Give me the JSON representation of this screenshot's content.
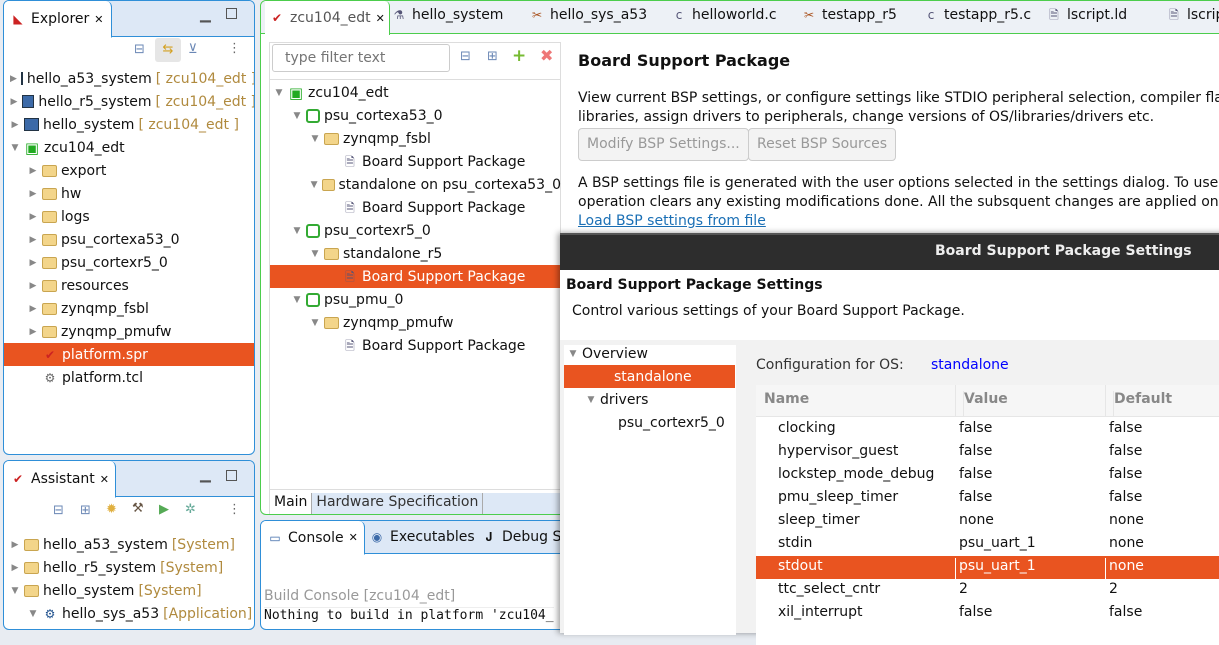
{
  "explorer": {
    "title": "Explorer",
    "items": [
      {
        "label": "hello_a53_system",
        "tag": "[ zcu104_edt ]",
        "expand": "right",
        "icon": "system"
      },
      {
        "label": "hello_r5_system",
        "tag": "[ zcu104_edt ]",
        "expand": "right",
        "icon": "system"
      },
      {
        "label": "hello_system",
        "tag": "[ zcu104_edt ]",
        "expand": "right",
        "icon": "system"
      },
      {
        "label": "zcu104_edt",
        "tag": "",
        "expand": "down",
        "icon": "platform"
      },
      {
        "label": "export",
        "tag": "",
        "expand": "right",
        "icon": "folder"
      },
      {
        "label": "hw",
        "tag": "",
        "expand": "right",
        "icon": "folder"
      },
      {
        "label": "logs",
        "tag": "",
        "expand": "right",
        "icon": "folder"
      },
      {
        "label": "psu_cortexa53_0",
        "tag": "",
        "expand": "right",
        "icon": "folder"
      },
      {
        "label": "psu_cortexr5_0",
        "tag": "",
        "expand": "right",
        "icon": "folder"
      },
      {
        "label": "resources",
        "tag": "",
        "expand": "right",
        "icon": "folder"
      },
      {
        "label": "zynqmp_fsbl",
        "tag": "",
        "expand": "right",
        "icon": "folder"
      },
      {
        "label": "zynqmp_pmufw",
        "tag": "",
        "expand": "right",
        "icon": "folder"
      },
      {
        "label": "platform.spr",
        "tag": "",
        "expand": "",
        "icon": "xilinx",
        "selected": true
      },
      {
        "label": "platform.tcl",
        "tag": "",
        "expand": "",
        "icon": "tcl"
      }
    ]
  },
  "assistant": {
    "title": "Assistant",
    "items": [
      {
        "label": "hello_a53_system",
        "tag": "[System]",
        "expand": "right"
      },
      {
        "label": "hello_r5_system",
        "tag": "[System]",
        "expand": "right"
      },
      {
        "label": "hello_system",
        "tag": "[System]",
        "expand": "down"
      },
      {
        "label": "hello_sys_a53",
        "tag": "[Application]",
        "expand": "down"
      }
    ]
  },
  "editor_tabs": [
    "zcu104_edt",
    "hello_system",
    "hello_sys_a53",
    "helloworld.c",
    "testapp_r5",
    "testapp_r5.c",
    "lscript.ld",
    "lscript"
  ],
  "platform_tree": {
    "filter_placeholder": "type filter text",
    "items": [
      {
        "label": "zcu104_edt",
        "level": 0,
        "icon": "platform"
      },
      {
        "label": "psu_cortexa53_0",
        "level": 1,
        "icon": "chip"
      },
      {
        "label": "zynqmp_fsbl",
        "level": 2,
        "icon": "folder"
      },
      {
        "label": "Board Support Package",
        "level": 3,
        "icon": "doc"
      },
      {
        "label": "standalone on psu_cortexa53_0",
        "level": 2,
        "icon": "folder"
      },
      {
        "label": "Board Support Package",
        "level": 3,
        "icon": "doc"
      },
      {
        "label": "psu_cortexr5_0",
        "level": 1,
        "icon": "chip"
      },
      {
        "label": "standalone_r5",
        "level": 2,
        "icon": "folder"
      },
      {
        "label": "Board Support Package",
        "level": 3,
        "icon": "doc",
        "selected": true
      },
      {
        "label": "psu_pmu_0",
        "level": 1,
        "icon": "chip"
      },
      {
        "label": "zynqmp_pmufw",
        "level": 2,
        "icon": "folder"
      },
      {
        "label": "Board Support Package",
        "level": 3,
        "icon": "doc"
      }
    ],
    "bottom_tabs": [
      "Main",
      "Hardware Specification"
    ]
  },
  "bsp": {
    "title": "Board Support Package",
    "desc1": "View current BSP settings, or configure settings like STDIO peripheral selection, compiler flags, S",
    "desc2": "libraries, assign drivers to peripherals, change versions of OS/libraries/drivers etc.",
    "modify": "Modify BSP Settings...",
    "reset": "Reset BSP Sources",
    "info1": "A BSP settings file is generated with the user options selected in the settings dialog. To use existin",
    "info2": "operation clears any existing modifications done. All the subsquent changes are applied on top o",
    "load": "Load BSP settings from file"
  },
  "console": {
    "tabs": [
      "Console",
      "Executables",
      "Debug Sh"
    ],
    "header": "Build Console [zcu104_edt]",
    "line": "Nothing to build in platform 'zcu104_"
  },
  "dialog": {
    "window_title": "Board Support Package Settings",
    "title": "Board Support Package Settings",
    "subtitle": "Control various settings of your Board Support Package.",
    "nav": [
      {
        "label": "Overview",
        "level": 0
      },
      {
        "label": "standalone",
        "level": 1,
        "selected": true
      },
      {
        "label": "drivers",
        "level": 1
      },
      {
        "label": "psu_cortexr5_0",
        "level": 2
      }
    ],
    "config_label": "Configuration for OS:",
    "config_value": "standalone",
    "columns": [
      "Name",
      "Value",
      "Default"
    ],
    "rows": [
      [
        "clocking",
        "false",
        "false"
      ],
      [
        "hypervisor_guest",
        "false",
        "false"
      ],
      [
        "lockstep_mode_debug",
        "false",
        "false"
      ],
      [
        "pmu_sleep_timer",
        "false",
        "false"
      ],
      [
        "sleep_timer",
        "none",
        "none"
      ],
      [
        "stdin",
        "psu_uart_1",
        "none"
      ],
      [
        "stdout",
        "psu_uart_1",
        "none"
      ],
      [
        "ttc_select_cntr",
        "2",
        "2"
      ],
      [
        "xil_interrupt",
        "false",
        "false"
      ]
    ],
    "selected_row": 6
  },
  "colors": {
    "accent": "#e95420",
    "panel_border": "#2f8fd8",
    "editor_border": "#4ccd4c",
    "link": "#0000ff"
  }
}
